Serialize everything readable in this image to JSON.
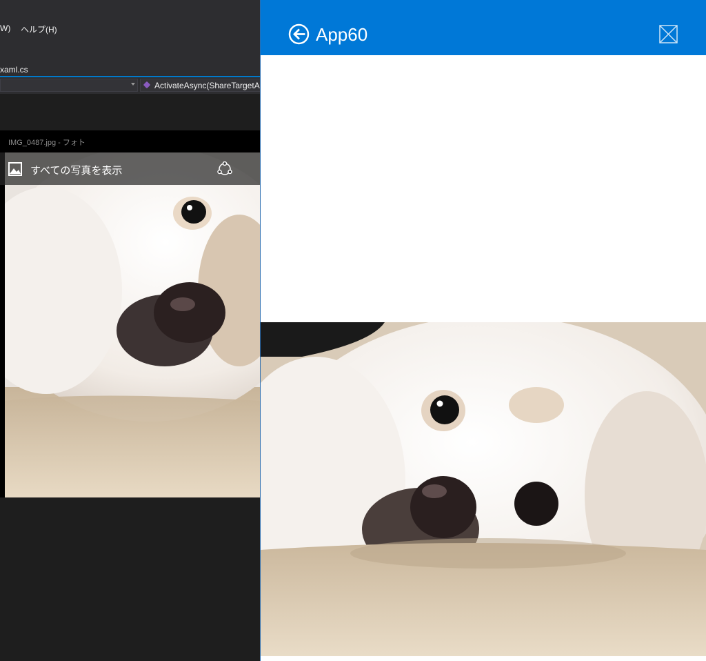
{
  "vs": {
    "menu_window": "W)",
    "menu_help": "ヘルプ(H)",
    "tab": "xaml.cs",
    "nav_method": "ActivateAsync(ShareTargetAc"
  },
  "photos": {
    "window_title": "IMG_0487.jpg - フォト",
    "all_photos": "すべての写真を表示",
    "icons": [
      "gallery-icon",
      "share-icon"
    ]
  },
  "app": {
    "title": "App60",
    "header_color": "#0078d7",
    "icons": [
      "back-arrow-icon",
      "close-box-icon"
    ]
  },
  "colors": {
    "vs_background": "#1e1e1e",
    "vs_accent": "#007acc",
    "app_background": "#ffffff"
  }
}
